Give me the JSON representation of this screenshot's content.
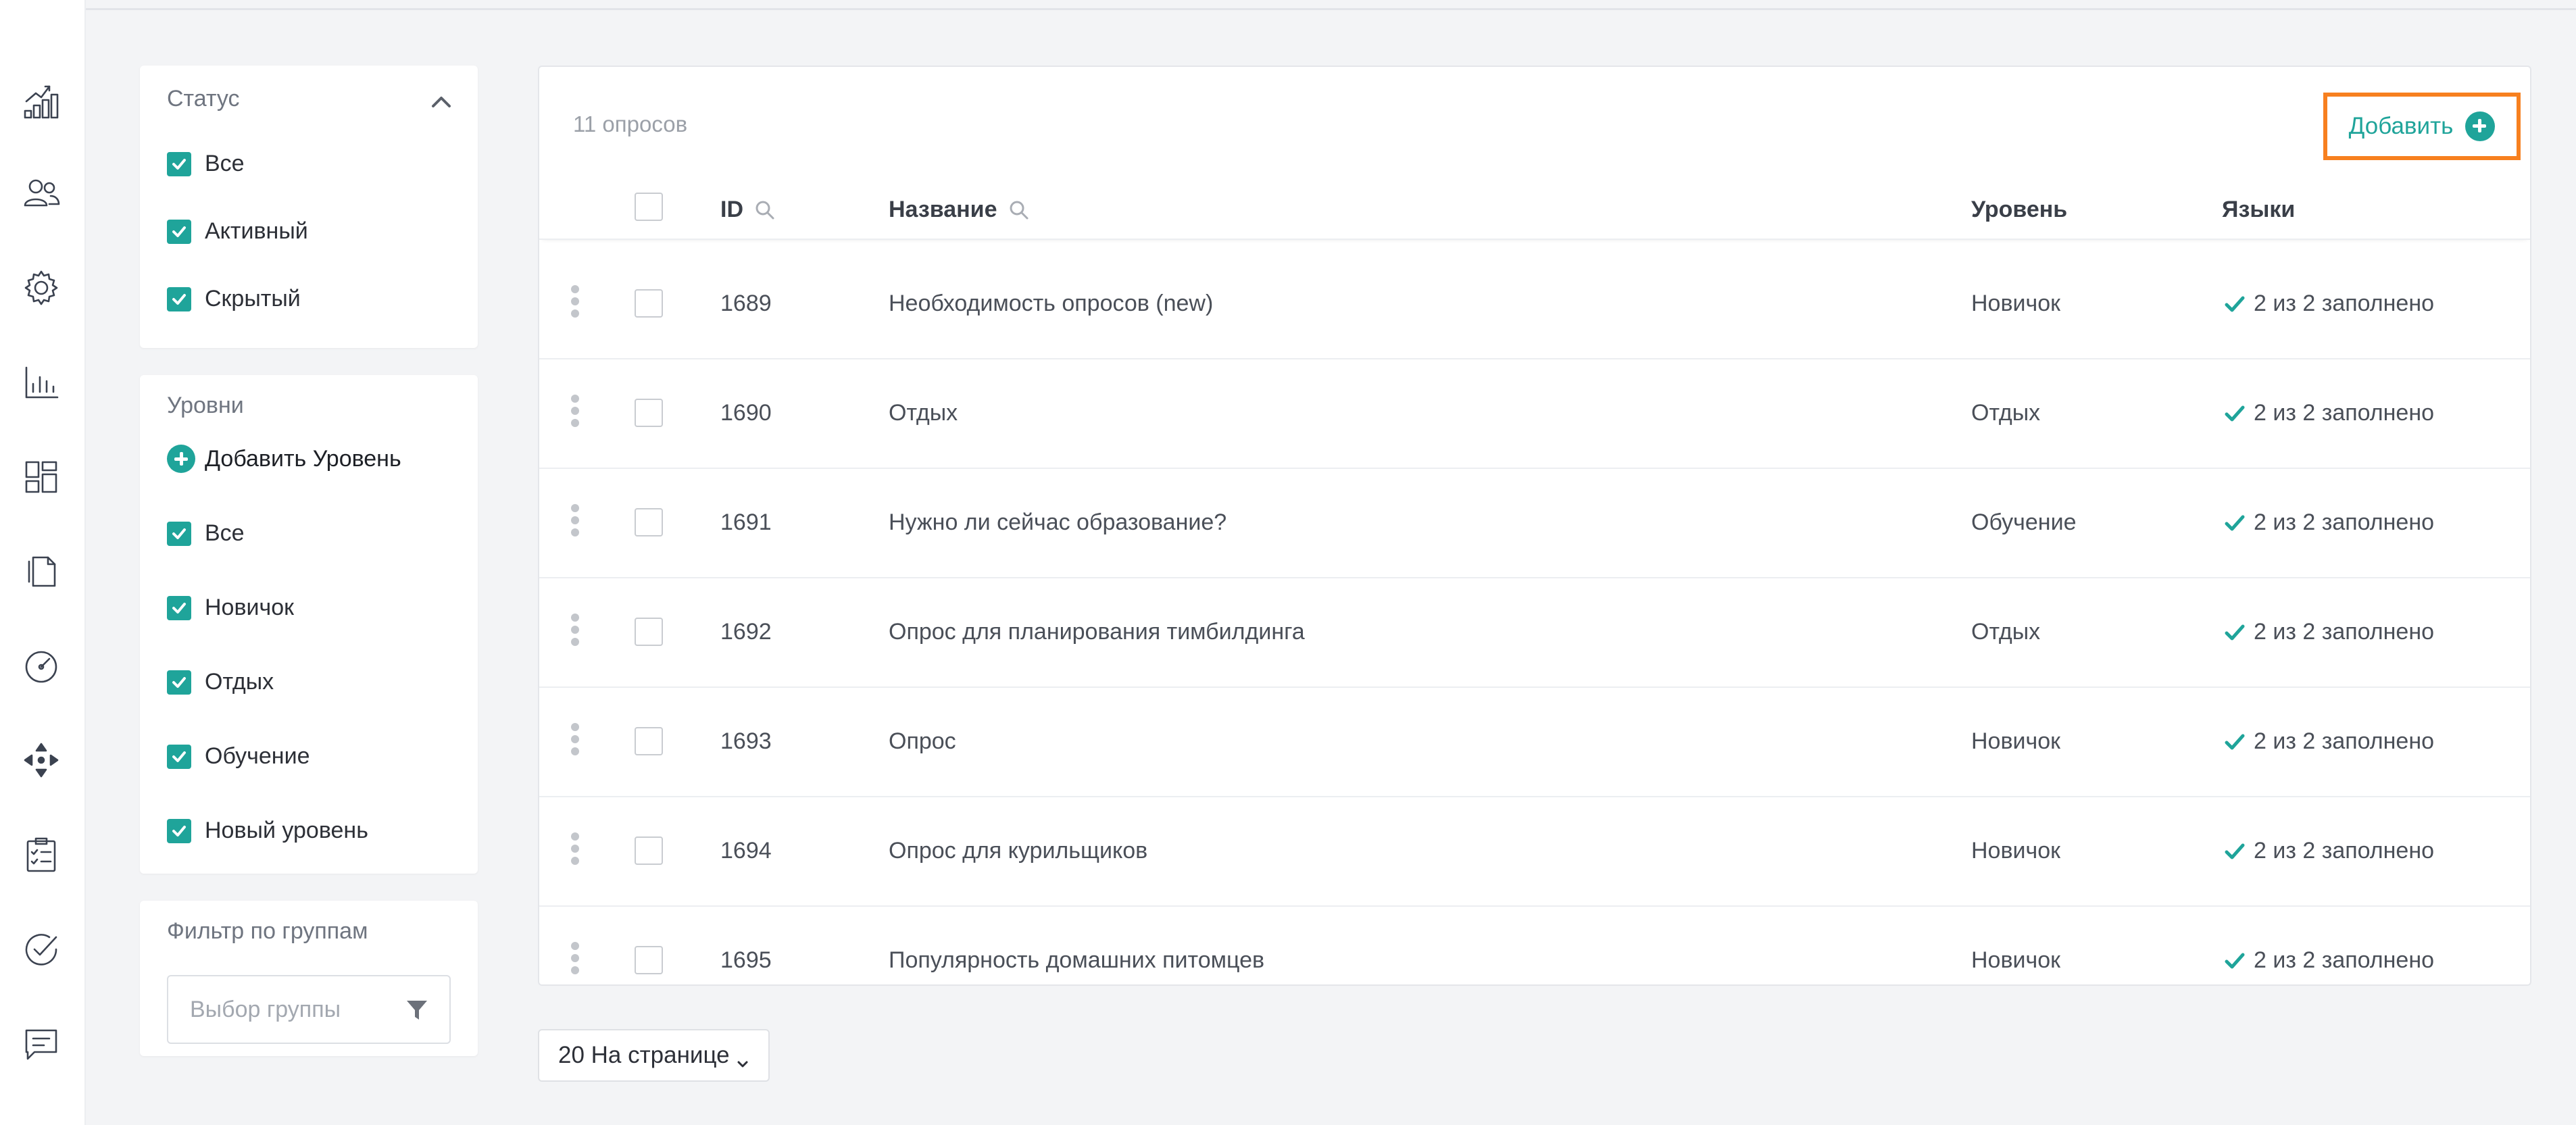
{
  "nav": {
    "icons": [
      "analytics-icon",
      "users-icon",
      "settings-icon",
      "bar-chart-icon",
      "dashboard-icon",
      "documents-icon",
      "speedometer-icon",
      "move-icon",
      "clipboard-checklist-icon",
      "check-circle-icon",
      "chat-icon"
    ]
  },
  "status_filter": {
    "title": "Статус",
    "options": [
      "Все",
      "Активный",
      "Скрытый"
    ]
  },
  "levels_filter": {
    "title": "Уровни",
    "add_label": "Добавить Уровень",
    "options": [
      "Все",
      "Новичок",
      "Отдых",
      "Обучение",
      "Новый уровень"
    ]
  },
  "group_filter": {
    "title": "Фильтр по группам",
    "placeholder": "Выбор группы"
  },
  "table": {
    "count_label": "11 опросов",
    "add_button": "Добавить",
    "columns": {
      "id": "ID",
      "name": "Название",
      "level": "Уровень",
      "languages": "Языки"
    },
    "rows": [
      {
        "id": "1689",
        "name": "Необходимость опросов (new)",
        "level": "Новичок",
        "languages": "2 из 2 заполнено"
      },
      {
        "id": "1690",
        "name": "Отдых",
        "level": "Отдых",
        "languages": "2 из 2 заполнено"
      },
      {
        "id": "1691",
        "name": "Нужно ли сейчас образование?",
        "level": "Обучение",
        "languages": "2 из 2 заполнено"
      },
      {
        "id": "1692",
        "name": "Опрос для планирования тимбилдинга",
        "level": "Отдых",
        "languages": "2 из 2 заполнено"
      },
      {
        "id": "1693",
        "name": "Опрос",
        "level": "Новичок",
        "languages": "2 из 2 заполнено"
      },
      {
        "id": "1694",
        "name": "Опрос для курильщиков",
        "level": "Новичок",
        "languages": "2 из 2 заполнено"
      },
      {
        "id": "1695",
        "name": "Популярность домашних питомцев",
        "level": "Новичок",
        "languages": "2 из 2 заполнено"
      }
    ]
  },
  "pagination": {
    "per_page_label": "20 На странице"
  },
  "colors": {
    "accent": "#1fa49a",
    "highlight": "#f7801f",
    "background": "#f3f4f6"
  }
}
